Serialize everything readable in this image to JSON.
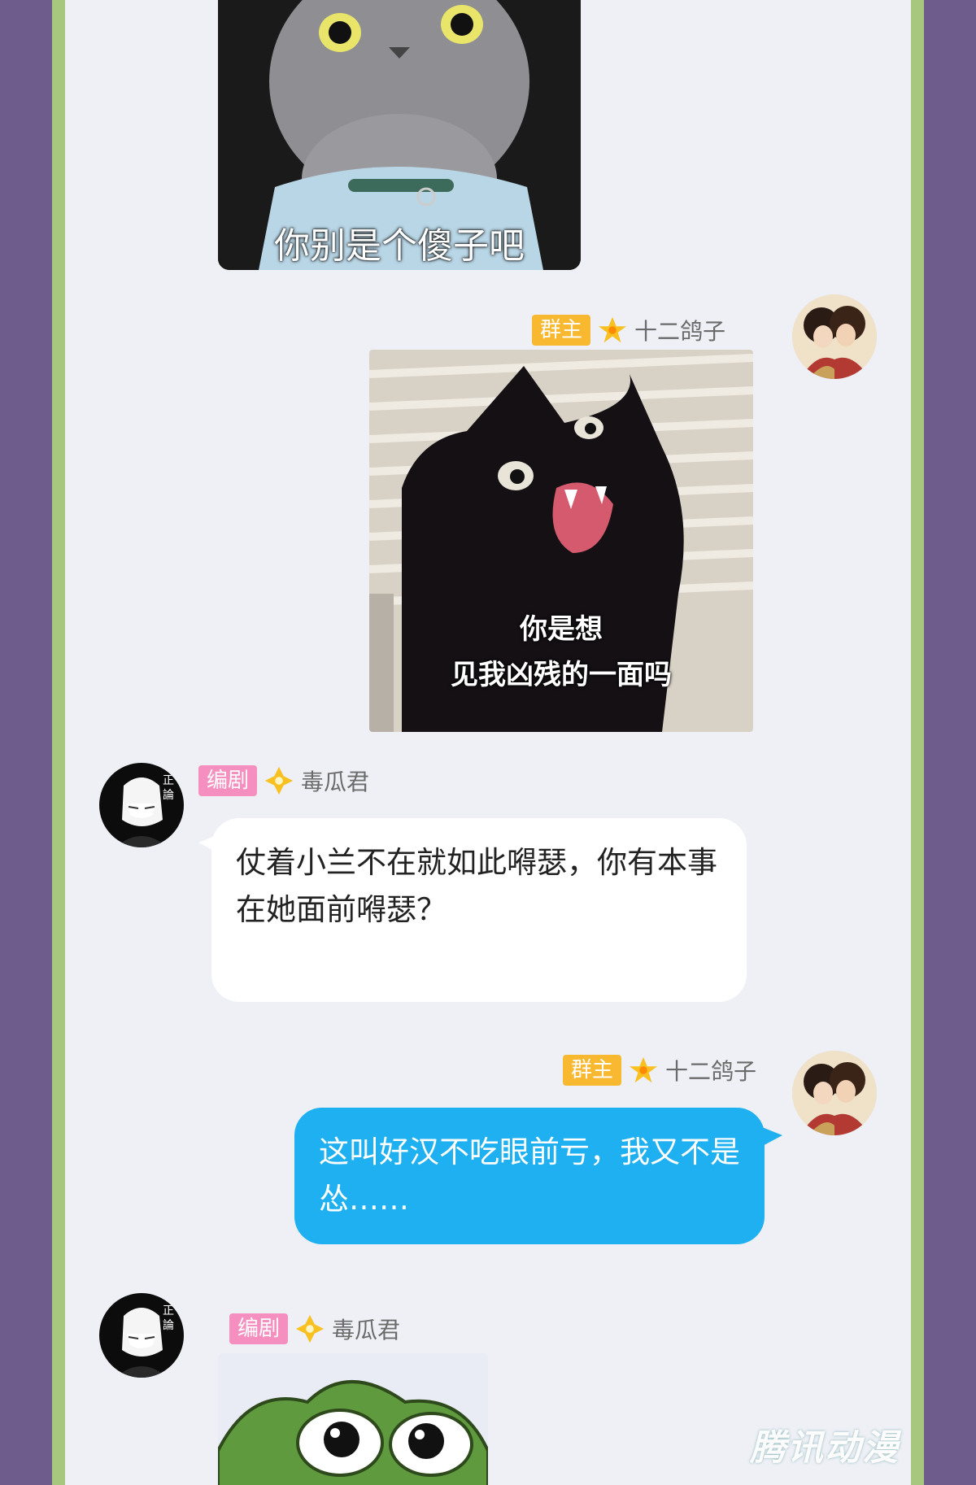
{
  "messages": [
    {
      "type": "sticker",
      "side": "left",
      "caption": "你别是个傻子吧",
      "image": "gray-cat-sticker"
    },
    {
      "type": "sticker",
      "side": "right",
      "badge": "群主",
      "sender": "十二鸽子",
      "caption_line1": "你是想",
      "caption_line2": "见我凶残的一面吗",
      "image": "black-cat-sticker"
    },
    {
      "type": "text",
      "side": "left",
      "badge": "编剧",
      "sender": "毒瓜君",
      "text": "仗着小兰不在就如此嘚瑟，你有本事在她面前嘚瑟？"
    },
    {
      "type": "text",
      "side": "right",
      "badge": "群主",
      "sender": "十二鸽子",
      "text": "这叫好汉不吃眼前亏，我又不是怂……"
    },
    {
      "type": "sticker",
      "side": "left",
      "badge": "编剧",
      "sender": "毒瓜君",
      "image": "frog-sticker"
    }
  ],
  "watermark": "腾讯动漫",
  "colors": {
    "owner_badge": "#f8b830",
    "editor_badge": "#f48fc0",
    "right_bubble": "#1eb0f0",
    "left_bubble": "#ffffff",
    "chat_background": "#eef0f6"
  }
}
